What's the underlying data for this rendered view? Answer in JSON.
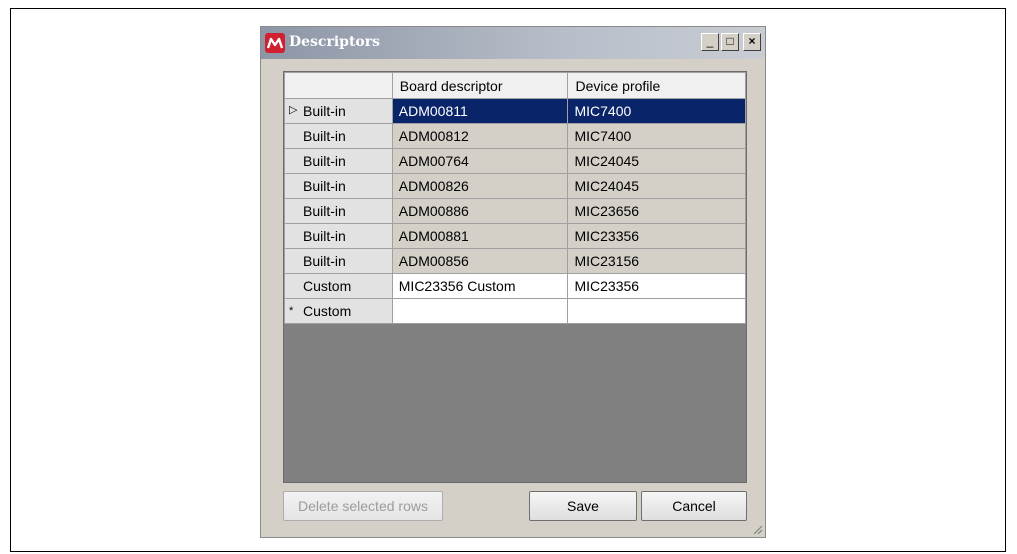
{
  "window": {
    "title": "Descriptors",
    "minimize_glyph": "_",
    "maximize_glyph": "□",
    "close_glyph": "×"
  },
  "grid": {
    "columns": [
      "Board descriptor",
      "Device profile"
    ],
    "rows": [
      {
        "type": "Built-in",
        "board": "ADM00811",
        "device": "MIC7400",
        "state": "selected"
      },
      {
        "type": "Built-in",
        "board": "ADM00812",
        "device": "MIC7400",
        "state": "builtin"
      },
      {
        "type": "Built-in",
        "board": "ADM00764",
        "device": "MIC24045",
        "state": "builtin"
      },
      {
        "type": "Built-in",
        "board": "ADM00826",
        "device": "MIC24045",
        "state": "builtin"
      },
      {
        "type": "Built-in",
        "board": "ADM00886",
        "device": "MIC23656",
        "state": "builtin"
      },
      {
        "type": "Built-in",
        "board": "ADM00881",
        "device": "MIC23356",
        "state": "builtin"
      },
      {
        "type": "Built-in",
        "board": "ADM00856",
        "device": "MIC23156",
        "state": "builtin"
      },
      {
        "type": "Custom",
        "board": "MIC23356 Custom",
        "device": "MIC23356",
        "state": "custom"
      },
      {
        "type": "Custom",
        "board": "",
        "device": "",
        "state": "newrow"
      }
    ]
  },
  "buttons": {
    "delete": "Delete selected rows",
    "save": "Save",
    "cancel": "Cancel"
  },
  "colors": {
    "selection": "#0a246a",
    "window_bg": "#d4d0c8",
    "grid_bg": "#808080"
  }
}
